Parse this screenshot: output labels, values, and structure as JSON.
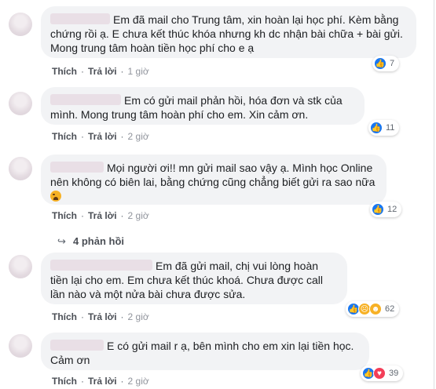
{
  "comments": [
    {
      "text": "Em đã mail cho Trung tâm, xin hoàn lại học phí. Kèm bằng chứng rồi ạ. E chưa kết thúc khóa nhưng kh dc nhận bài chữa + bài gửi. Mong trung tâm hoàn tiền học phí cho e ạ",
      "like_label": "Thích",
      "reply_label": "Trả lời",
      "time": "1 giờ",
      "reaction_count": "7"
    },
    {
      "text": "Em có gửi mail phản hồi, hóa đơn và stk của mình. Mong trung tâm hoàn phí cho em. Xin cảm ơn.",
      "like_label": "Thích",
      "reply_label": "Trả lời",
      "time": "2 giờ",
      "reaction_count": "11"
    },
    {
      "text": "Mọi người ơi!! mn gửi mail sao vậy ạ. Mình học Online nên không có biên lai, bằng chứng cũng chẳng biết gửi ra sao nữa",
      "like_label": "Thích",
      "reply_label": "Trả lời",
      "time": "2 giờ",
      "reaction_count": "12"
    },
    {
      "text": "Em đã gửi mail, chị vui lòng hoàn tiền lại cho em. Em chưa kết thúc khoá. Chưa được call lần nào và một nửa bài chưa được sửa.",
      "like_label": "Thích",
      "reply_label": "Trả lời",
      "time": "2 giờ",
      "reaction_count": "62"
    },
    {
      "text": "E có gửi mail r ạ, bên mình cho em xin lại tiền học. Cảm ơn",
      "like_label": "Thích",
      "reply_label": "Trả lời",
      "time": "2 giờ",
      "reaction_count": "39"
    }
  ],
  "replies_link": "4 phản hồi",
  "icons": {
    "like": "like-reaction-icon",
    "love": "love-reaction-icon",
    "sad": "sad-reaction-icon",
    "haha": "haha-reaction-icon",
    "reply_arrow": "reply-arrow-icon",
    "crying_emoji": "crying-emoji-icon"
  },
  "colors": {
    "like_blue": "#1877f2",
    "love_red": "#f33e58",
    "bubble_bg": "#f2f3f5",
    "action_text": "#4b4f56"
  }
}
